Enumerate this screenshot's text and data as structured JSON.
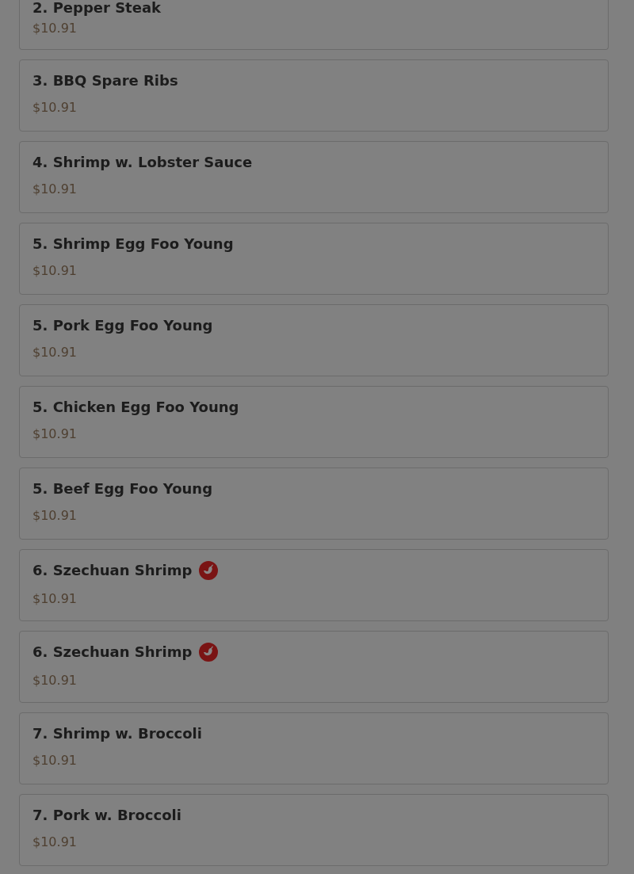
{
  "items": [
    {
      "name": "2. Pepper Steak",
      "price": "$10.91",
      "spicy": false
    },
    {
      "name": "3. BBQ Spare Ribs",
      "price": "$10.91",
      "spicy": false
    },
    {
      "name": "4. Shrimp w. Lobster Sauce",
      "price": "$10.91",
      "spicy": false
    },
    {
      "name": "5. Shrimp Egg Foo Young",
      "price": "$10.91",
      "spicy": false
    },
    {
      "name": "5. Pork Egg Foo Young",
      "price": "$10.91",
      "spicy": false
    },
    {
      "name": "5. Chicken Egg Foo Young",
      "price": "$10.91",
      "spicy": false
    },
    {
      "name": "5. Beef Egg Foo Young",
      "price": "$10.91",
      "spicy": false
    },
    {
      "name": "6. Szechuan Shrimp",
      "price": "$10.91",
      "spicy": true
    },
    {
      "name": "6. Szechuan Shrimp",
      "price": "$10.91",
      "spicy": true
    },
    {
      "name": "7. Shrimp w. Broccoli",
      "price": "$10.91",
      "spicy": false
    },
    {
      "name": "7. Pork w. Broccoli",
      "price": "$10.91",
      "spicy": false
    }
  ]
}
